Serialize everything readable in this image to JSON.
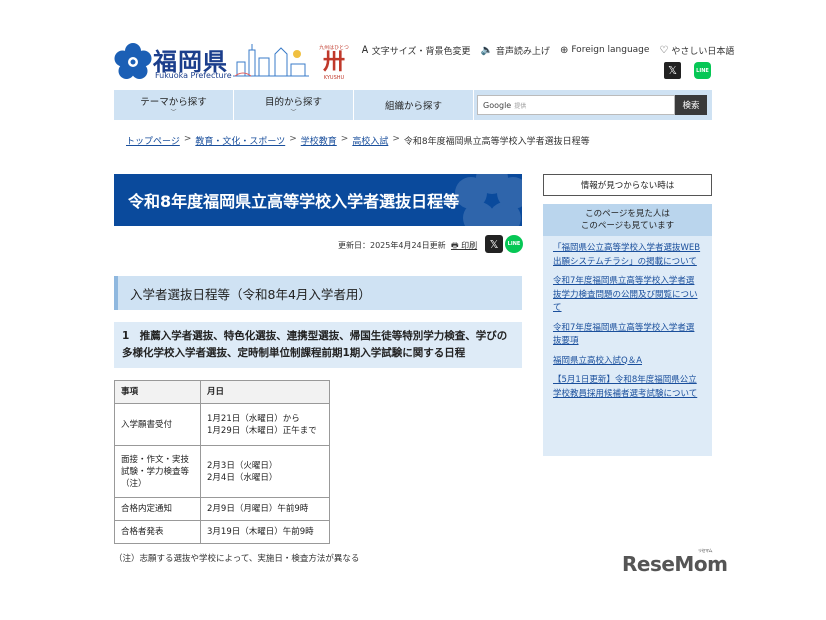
{
  "header": {
    "logo_title": "福岡県",
    "logo_sub": "Fukuoka Prefecture",
    "kyushu_top": "九州はひとつ",
    "kyushu_mark": "卅",
    "kyushu_bottom": "KYUSHU",
    "utils": [
      {
        "icon": "text-size-icon",
        "glyph": "Ꭺ",
        "label": "文字サイズ・背景色変更"
      },
      {
        "icon": "speaker-icon",
        "glyph": "🔈",
        "label": "音声読み上げ"
      },
      {
        "icon": "globe-icon",
        "glyph": "⊕",
        "label": "Foreign language"
      },
      {
        "icon": "heart-icon",
        "glyph": "♡",
        "label": "やさしい日本語"
      }
    ],
    "sns_x": "𝕏",
    "sns_line": "LINE"
  },
  "nav": {
    "items": [
      "テーマから探す",
      "目的から探す",
      "組織から探す"
    ],
    "chevron": "﹀",
    "search_brand": "Google",
    "search_placeholder": "提供",
    "search_button": "検索"
  },
  "breadcrumb": {
    "links": [
      "トップページ",
      "教育・文化・スポーツ",
      "学校教育",
      "高校入試"
    ],
    "current": "令和8年度福岡県立高等学校入学者選抜日程等",
    "separator": ">"
  },
  "main": {
    "title": "令和8年度福岡県立高等学校入学者選抜日程等",
    "updated": "更新日：2025年4月24日更新",
    "print_label": "🖶 印刷",
    "h2": "入学者選抜日程等（令和8年4月入学者用）",
    "h3": "1　推薦入学者選抜、特色化選抜、連携型選抜、帰国生徒等特別学力検査、学びの多様化学校入学者選抜、定時制単位制課程前期1期入学試験に関する日程",
    "table": {
      "headers": [
        "事項",
        "月日"
      ],
      "rows": [
        [
          "入学願書受付",
          "1月21日（水曜日）から\n1月29日（木曜日）正午まで"
        ],
        [
          "面接・作文・実技試験・学力検査等（注）",
          "2月3日（火曜日）\n2月4日（水曜日）"
        ],
        [
          "合格内定通知",
          "2月9日（月曜日）午前9時"
        ],
        [
          "合格者発表",
          "3月19日（木曜日）午前9時"
        ]
      ]
    },
    "note": "（注）志願する選抜や学校によって、実施日・検査方法が異なる"
  },
  "sidebar": {
    "notfound": "情報が見つからない時は",
    "head": "このページを見た人は\nこのページも見ています",
    "links": [
      "「福岡県公立高等学校入学者選抜WEB出願システムチラシ」の掲載について",
      "令和7年度福岡県立高等学校入学者選抜学力検査問題の公開及び閲覧について",
      "令和7年度福岡県立高等学校入学者選抜要項",
      "福岡県立高校入試Q＆A",
      "【5月1日更新】令和8年度福岡県公立学校教員採用候補者選考試験について"
    ]
  },
  "watermark": {
    "text": "ReseMom",
    "small": "リセマム"
  },
  "colors": {
    "title_bg": "#0a4a9c",
    "nav_bg": "#cfe2f3",
    "side_bg": "#deebf7",
    "link": "#1a4f9c"
  }
}
